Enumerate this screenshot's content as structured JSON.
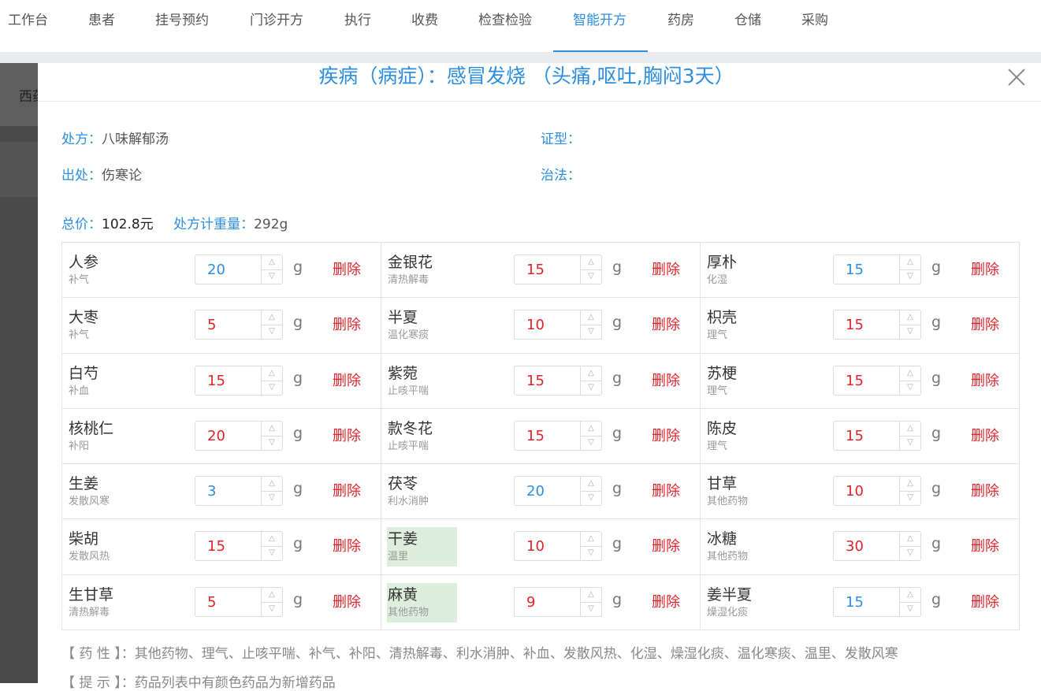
{
  "nav": {
    "items": [
      "工作台",
      "患者",
      "挂号预约",
      "门诊开方",
      "执行",
      "收费",
      "检查检验",
      "智能开方",
      "药房",
      "仓储",
      "采购"
    ],
    "active": "智能开方"
  },
  "background": {
    "partial_text": "西药"
  },
  "modal": {
    "title": "疾病（病症）：感冒发烧 （头痛,呕吐,胸闷3天）",
    "prescription_label": "处方：",
    "prescription_value": "八味解郁汤",
    "source_label": "出处：",
    "source_value": "伤寒论",
    "syndrome_label": "证型：",
    "syndrome_value": "",
    "treatment_label": "治法：",
    "treatment_value": "",
    "total_label": "总价：",
    "total_value": "102.8元",
    "weight_label": "处方计重量：",
    "weight_value": "292g",
    "unit": "g",
    "delete_label": "删除",
    "herbs": [
      {
        "name": "人参",
        "property": "补气",
        "dose": "20",
        "color": "blue",
        "new": false
      },
      {
        "name": "金银花",
        "property": "清热解毒",
        "dose": "15",
        "color": "red",
        "new": false
      },
      {
        "name": "厚朴",
        "property": "化湿",
        "dose": "15",
        "color": "blue",
        "new": false
      },
      {
        "name": "大枣",
        "property": "补气",
        "dose": "5",
        "color": "red",
        "new": false
      },
      {
        "name": "半夏",
        "property": "温化寒痰",
        "dose": "10",
        "color": "red",
        "new": false
      },
      {
        "name": "枳壳",
        "property": "理气",
        "dose": "15",
        "color": "red",
        "new": false
      },
      {
        "name": "白芍",
        "property": "补血",
        "dose": "15",
        "color": "red",
        "new": false
      },
      {
        "name": "紫菀",
        "property": "止咳平喘",
        "dose": "15",
        "color": "red",
        "new": false
      },
      {
        "name": "苏梗",
        "property": "理气",
        "dose": "15",
        "color": "red",
        "new": false
      },
      {
        "name": "核桃仁",
        "property": "补阳",
        "dose": "20",
        "color": "red",
        "new": false
      },
      {
        "name": "款冬花",
        "property": "止咳平喘",
        "dose": "15",
        "color": "red",
        "new": false
      },
      {
        "name": "陈皮",
        "property": "理气",
        "dose": "15",
        "color": "red",
        "new": false
      },
      {
        "name": "生姜",
        "property": "发散风寒",
        "dose": "3",
        "color": "blue",
        "new": false
      },
      {
        "name": "茯苓",
        "property": "利水消肿",
        "dose": "20",
        "color": "blue",
        "new": false
      },
      {
        "name": "甘草",
        "property": "其他药物",
        "dose": "10",
        "color": "red",
        "new": false
      },
      {
        "name": "柴胡",
        "property": "发散风热",
        "dose": "15",
        "color": "red",
        "new": false
      },
      {
        "name": "干姜",
        "property": "温里",
        "dose": "10",
        "color": "red",
        "new": true
      },
      {
        "name": "冰糖",
        "property": "其他药物",
        "dose": "30",
        "color": "red",
        "new": false
      },
      {
        "name": "生甘草",
        "property": "清热解毒",
        "dose": "5",
        "color": "red",
        "new": false
      },
      {
        "name": "麻黄",
        "property": "其他药物",
        "dose": "9",
        "color": "red",
        "new": true
      },
      {
        "name": "姜半夏",
        "property": "燥湿化痰",
        "dose": "15",
        "color": "blue",
        "new": false
      }
    ],
    "property_note": "【 药 性 】：其他药物、理气、止咳平喘、补气、补阳、清热解毒、利水消肿、补血、发散风热、化湿、燥湿化痰、温化寒痰、温里、发散风寒",
    "hint_note": "【 提 示 】：药品列表中有颜色药品为新增药品"
  },
  "colors": {
    "accent": "#2d8ee0",
    "danger": "#e0242a",
    "new_herb_bg": "#ddeedd"
  }
}
